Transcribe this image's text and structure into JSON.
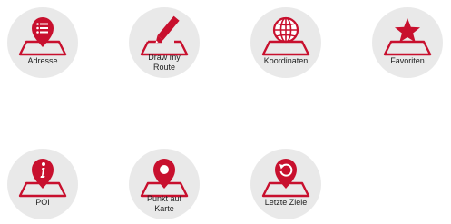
{
  "accent_color": "#c8102e",
  "menu": {
    "items": [
      {
        "label": "Adresse",
        "icon": "address-list-pin-icon"
      },
      {
        "label": "Draw my\nRoute",
        "icon": "pencil-map-icon"
      },
      {
        "label": "Koordinaten",
        "icon": "globe-map-icon"
      },
      {
        "label": "Favoriten",
        "icon": "star-map-icon"
      },
      {
        "label": "POI",
        "icon": "info-pin-icon"
      },
      {
        "label": "Punkt auf\nKarte",
        "icon": "location-pin-icon"
      },
      {
        "label": "Letzte Ziele",
        "icon": "history-pin-icon"
      }
    ]
  }
}
